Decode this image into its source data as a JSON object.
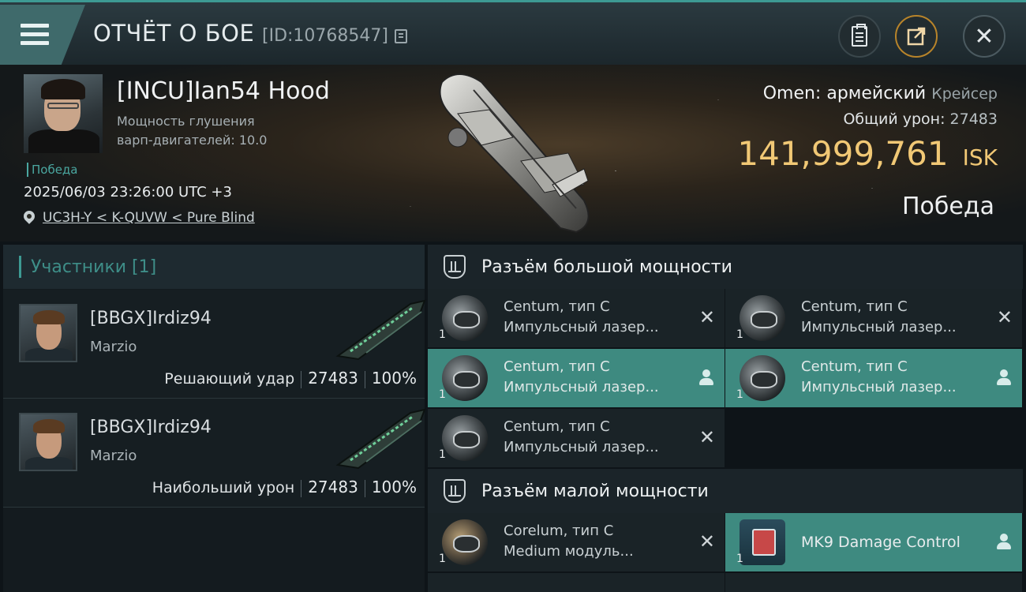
{
  "header": {
    "title": "ОТЧЁТ О БОЕ",
    "report_id": "[ID:10768547]",
    "buttons": {
      "menu": "menu",
      "clipboard": "clipboard",
      "share": "share",
      "close": "✕"
    }
  },
  "victim": {
    "pilot": "[INCU]Ian54 Hood",
    "warp_line1": "Мощность глушения",
    "warp_line2": "варп-двигателей: 10.0",
    "tag": "Победа",
    "datetime": "2025/06/03 23:26:00 UTC +3",
    "location": "UC3H-Y < K-QUVW < Pure Blind",
    "ship": "Omen: армейский",
    "ship_class": "Крейсер",
    "damage_label": "Общий урон:",
    "damage_value": "27483",
    "isk_value": "141,999,761",
    "isk_unit": "ISK",
    "result": "Победа"
  },
  "participants": {
    "title": "Участники [1]",
    "items": [
      {
        "name": "[BBGX]Irdiz94",
        "corp": "Marzio",
        "role": "Решающий удар",
        "damage": "27483",
        "percent": "100%"
      },
      {
        "name": "[BBGX]Irdiz94",
        "corp": "Marzio",
        "role": "Наибольший урон",
        "damage": "27483",
        "percent": "100%"
      }
    ]
  },
  "high_slots": {
    "title": "Разъём большой мощности",
    "modules": [
      {
        "qty": "1",
        "name": "Centum, тип C",
        "desc": "Импульсный лазер...",
        "state": "destroyed"
      },
      {
        "qty": "1",
        "name": "Centum, тип C",
        "desc": "Импульсный лазер...",
        "state": "destroyed"
      },
      {
        "qty": "1",
        "name": "Centum, тип C",
        "desc": "Импульсный лазер...",
        "state": "dropped"
      },
      {
        "qty": "1",
        "name": "Centum, тип C",
        "desc": "Импульсный лазер...",
        "state": "dropped"
      },
      {
        "qty": "1",
        "name": "Centum, тип C",
        "desc": "Импульсный лазер...",
        "state": "destroyed"
      }
    ]
  },
  "low_slots": {
    "title": "Разъём малой мощности",
    "modules": [
      {
        "qty": "1",
        "name": "Corelum, тип C",
        "desc": "Medium модуль...",
        "state": "destroyed"
      },
      {
        "qty": "1",
        "name": "MK9 Damage Control",
        "desc": "",
        "state": "dropped"
      }
    ]
  },
  "colors": {
    "accent": "#3d9a93",
    "isk": "#f1c875",
    "dropped_bg": "#3e8a80"
  }
}
